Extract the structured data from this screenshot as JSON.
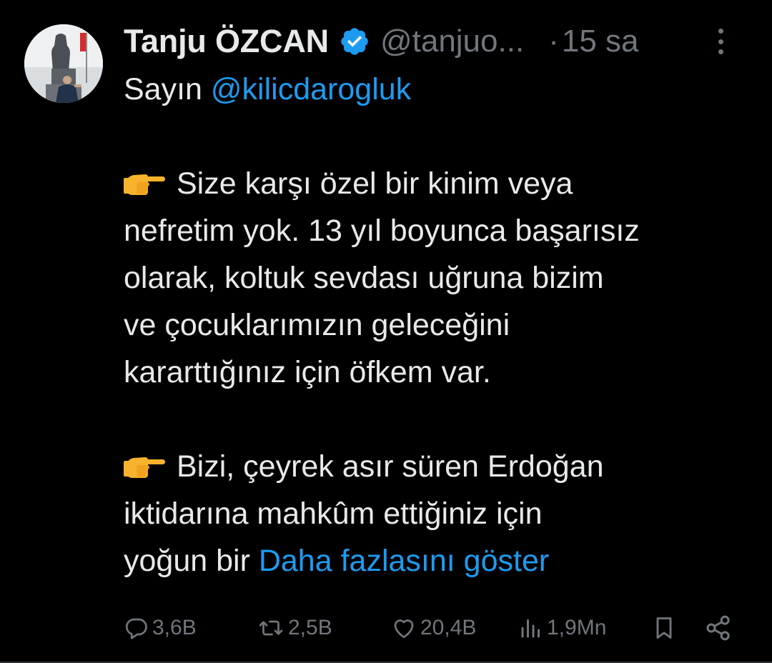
{
  "tweet": {
    "author_name": "Tanju ÖZCAN",
    "handle": "@tanjuo...",
    "separator": "·",
    "time": "15 sa",
    "avatar_icon": "profile-photo-statue",
    "verified_icon": "verified-badge-icon",
    "verified_color": "#1d9bf0",
    "body": {
      "greeting": "Sayın ",
      "mention": "@kilicdarogluk",
      "p1": [
        "Size karşı özel bir kinim veya",
        "nefretim yok. 13 yıl boyunca başarısız",
        "olarak, koltuk sevdası uğruna bizim",
        "ve çocuklarımızın geleceğini",
        "kararttığınız için öfkem var."
      ],
      "p2": [
        "Bizi, çeyrek asır süren Erdoğan",
        "iktidarına mahkûm ettiğiniz için"
      ],
      "last_line": "yoğun bir ",
      "show_more": "Daha fazlasını göster",
      "emoji": "backhand-index-pointing-right"
    },
    "actions": {
      "reply_count": "3,6B",
      "retweet_count": "2,5B",
      "like_count": "20,4B",
      "views_count": "1,9Mn"
    },
    "colors": {
      "background": "#000000",
      "text": "#e7e9ea",
      "muted": "#71767b",
      "link": "#1d9bf0"
    }
  }
}
